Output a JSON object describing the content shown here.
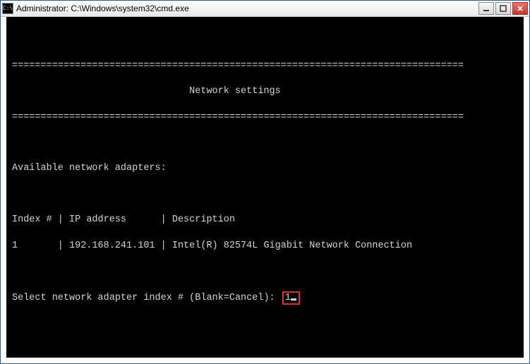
{
  "window": {
    "title": "Administrator: C:\\Windows\\system32\\cmd.exe"
  },
  "terminal": {
    "rule_top": "===============================================================================",
    "header_title": "                               Network settings",
    "rule_bottom": "===============================================================================",
    "available_label": "Available network adapters:",
    "columns_line": "Index # | IP address      | Description",
    "row_line": "1       | 192.168.241.101 | Intel(R) 82574L Gigabit Network Connection",
    "prompt_text": "Select network adapter index # (Blank=Cancel): ",
    "input_value": "1"
  }
}
